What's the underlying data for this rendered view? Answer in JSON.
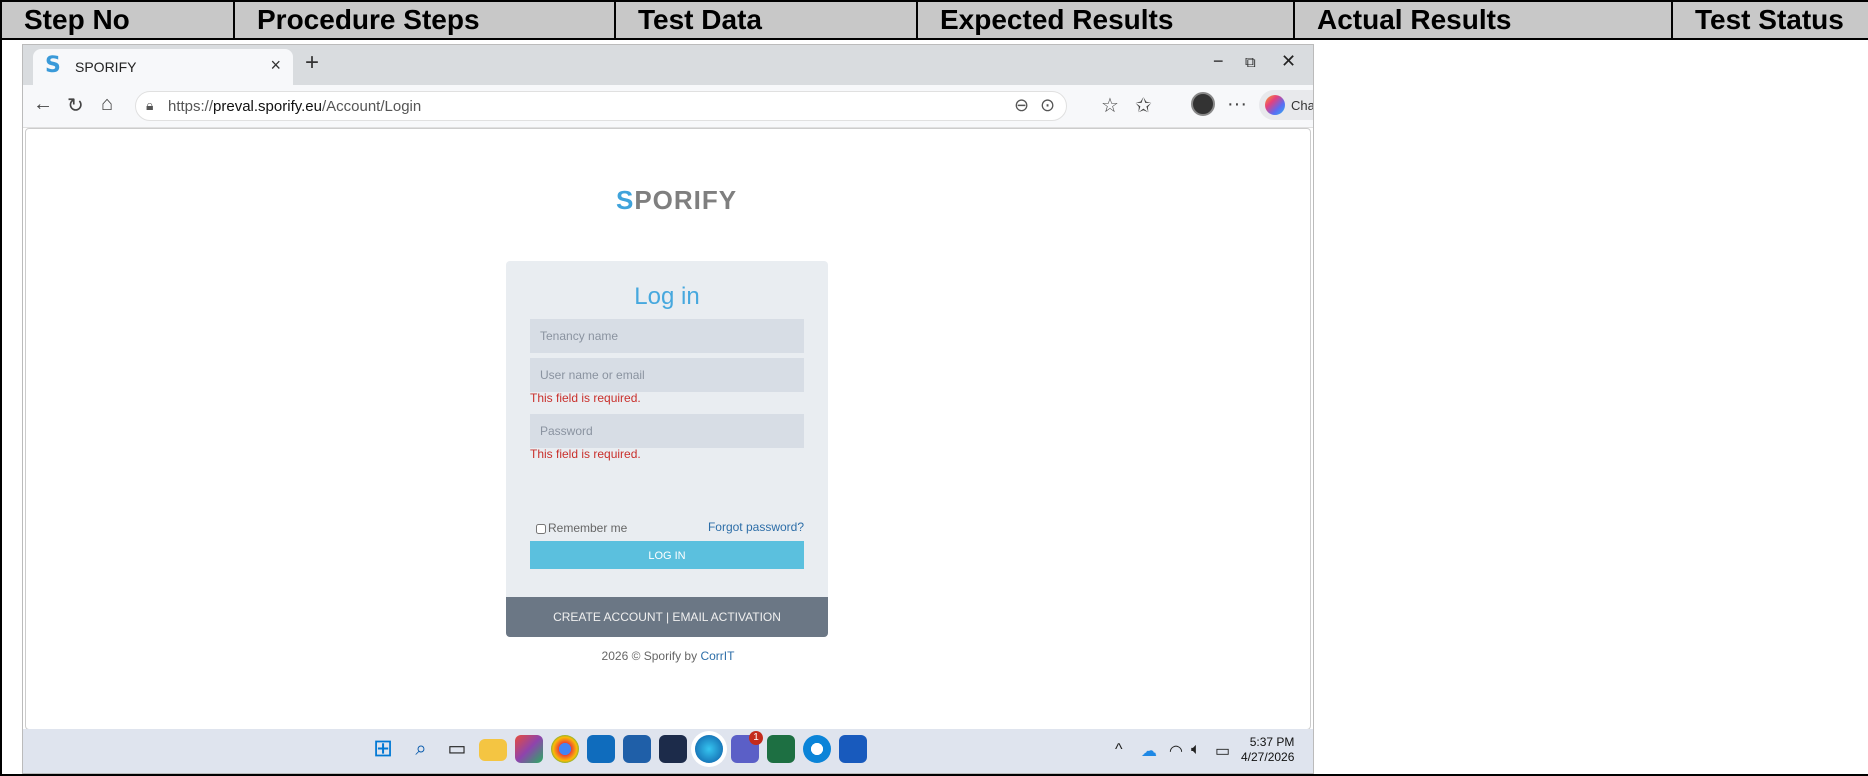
{
  "table": {
    "headers": [
      "Step No",
      "Procedure Steps",
      "Test Data",
      "Expected Results",
      "Actual Results",
      "Test Status"
    ]
  },
  "browser": {
    "tab_title": "SPORIFY",
    "tab_close": "×",
    "new_tab": "+",
    "window_controls": {
      "minimize": "−",
      "restore": "⧉",
      "close": "✕"
    },
    "url_prefix": "https://",
    "url_domain": "preval.sporify.eu",
    "url_path": "/Account/Login",
    "chat_label": "Chat"
  },
  "page": {
    "logo_s": "S",
    "logo_rest": "PORIFY",
    "title": "Log in",
    "tenancy_placeholder": "Tenancy name",
    "username_placeholder": "User name or email",
    "password_placeholder": "Password",
    "error_required": "This field is required.",
    "remember_me": "Remember me",
    "forgot_password": "Forgot password?",
    "login_button": "LOG IN",
    "footer_links": "CREATE ACCOUNT | EMAIL ACTIVATION",
    "copyright_prefix": "2026 © Sporify by ",
    "copyright_link": "CorrIT"
  },
  "taskbar": {
    "time": "5:37 PM",
    "date": "4/27/2026",
    "teams_badge": "1"
  },
  "colors": {
    "accent": "#46a8de",
    "login_button": "#5bc0de",
    "error": "#c9302c",
    "footer_bar": "#6b7785"
  }
}
